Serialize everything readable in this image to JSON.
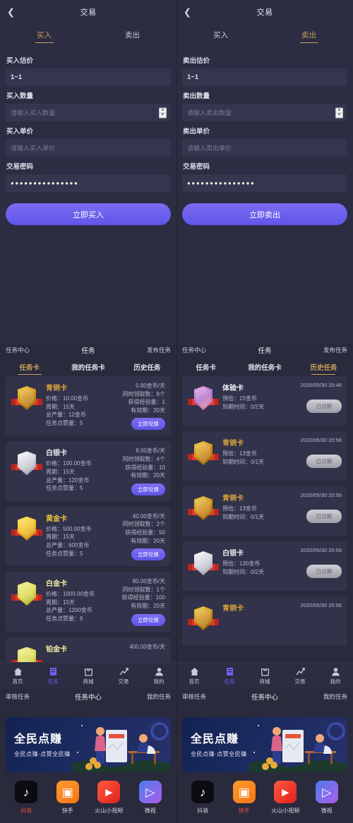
{
  "colors": {
    "background": "#2a2a3d",
    "panel": "#2c2c42",
    "card": "#32324a",
    "accent_gold": "#c9a25a",
    "accent_purple": "#6f62ee",
    "active_red": "#e8503a"
  },
  "trade": {
    "back_icon": "chevron-left-icon",
    "title": "交易",
    "tabs": [
      {
        "label": "买入"
      },
      {
        "label": "卖出"
      }
    ],
    "buy": {
      "active_tab": 0,
      "fields": [
        {
          "label": "买入估价",
          "value": "1~1",
          "placeholder": "",
          "type": "value"
        },
        {
          "label": "买入数量",
          "value": "",
          "placeholder": "请输入买入数量",
          "type": "spinner"
        },
        {
          "label": "买入单价",
          "value": "",
          "placeholder": "请输入买入单价",
          "type": "text"
        },
        {
          "label": "交易密码",
          "value": "●●●●●●●●●●●●●●●",
          "placeholder": "",
          "type": "password"
        }
      ],
      "submit_label": "立即买入"
    },
    "sell": {
      "active_tab": 1,
      "fields": [
        {
          "label": "卖出估价",
          "value": "1~1",
          "placeholder": "",
          "type": "value"
        },
        {
          "label": "卖出数量",
          "value": "",
          "placeholder": "请输入卖出数量",
          "type": "spinner"
        },
        {
          "label": "卖出单价",
          "value": "",
          "placeholder": "请输入卖出单价",
          "type": "text"
        },
        {
          "label": "交易密码",
          "value": "●●●●●●●●●●●●●●●",
          "placeholder": "",
          "type": "password"
        }
      ],
      "submit_label": "立即卖出"
    }
  },
  "task_header": {
    "left": "任务中心",
    "center": "任务",
    "right": "发布任务"
  },
  "task_tabs": [
    {
      "label": "任务卡"
    },
    {
      "label": "我的任务卡"
    },
    {
      "label": "历史任务"
    }
  ],
  "task_cards": {
    "active_tab": 0,
    "items": [
      {
        "name": "青铜卡",
        "tier": "bronze",
        "price": "价格：10.00金币",
        "cycle": "周期：15天",
        "total": "总产量：12金币",
        "points": "任务点赞量：5",
        "rate": "0.80金币/天",
        "concurrent": "同时领取数：8个",
        "exp": "获得经验量：1",
        "valid": "有效期：20天",
        "button": "立即兑换"
      },
      {
        "name": "白银卡",
        "tier": "silver",
        "price": "价格：100.00金币",
        "cycle": "周期：15天",
        "total": "总产量：120金币",
        "points": "任务点赞量：5",
        "rate": "8.00金币/天",
        "concurrent": "同时领取数：4个",
        "exp": "获得经验量：10",
        "valid": "有效期：20天",
        "button": "立即兑换"
      },
      {
        "name": "黄金卡",
        "tier": "gold",
        "price": "价格：500.00金币",
        "cycle": "周期：15天",
        "total": "总产量：600金币",
        "points": "任务点赞量：5",
        "rate": "40.00金币/天",
        "concurrent": "同时领取数：2个",
        "exp": "获得经验量：50",
        "valid": "有效期：20天",
        "button": "立即兑换"
      },
      {
        "name": "白金卡",
        "tier": "plat",
        "price": "价格：1000.00金币",
        "cycle": "周期：15天",
        "total": "总产量：1200金币",
        "points": "任务点赞量：6",
        "rate": "80.00金币/天",
        "concurrent": "同时领取数：1个",
        "exp": "获得经验量：100",
        "valid": "有效期：20天",
        "button": "立即兑换"
      },
      {
        "name": "铂金卡",
        "tier": "plat",
        "price": "",
        "cycle": "",
        "total": "",
        "points": "",
        "rate": "400.00金币/天",
        "concurrent": "",
        "exp": "",
        "valid": "",
        "button": ""
      }
    ]
  },
  "history_tasks": {
    "active_tab": 2,
    "items": [
      {
        "name": "体验卡",
        "tier": "exp",
        "estimate": "预估：15金币",
        "expiry": "到期时间：0/2天",
        "date": "2020/05/30 20:46",
        "status": "已过期"
      },
      {
        "name": "青铜卡",
        "tier": "bronze",
        "estimate": "预估：13金币",
        "expiry": "到期时间：0/1天",
        "date": "2020/05/30 20:56",
        "status": "已过期"
      },
      {
        "name": "青铜卡",
        "tier": "bronze",
        "estimate": "预估：13金币",
        "expiry": "到期时间：0/1天",
        "date": "2020/05/30 20:56",
        "status": "已过期"
      },
      {
        "name": "白银卡",
        "tier": "silver",
        "estimate": "预估：130金币",
        "expiry": "到期时间：0/2天",
        "date": "2020/05/30 20:56",
        "status": "已过期"
      },
      {
        "name": "青铜卡",
        "tier": "bronze",
        "estimate": "",
        "expiry": "",
        "date": "2020/05/30 20:56",
        "status": ""
      }
    ]
  },
  "bottom_nav": {
    "active_index": 1,
    "items": [
      {
        "label": "首页",
        "icon": "home-icon"
      },
      {
        "label": "任务",
        "icon": "task-icon"
      },
      {
        "label": "商城",
        "icon": "shop-bag-icon"
      },
      {
        "label": "交易",
        "icon": "chart-trend-icon"
      },
      {
        "label": "我的",
        "icon": "person-icon"
      }
    ]
  },
  "sub_nav": {
    "left": "审核任务",
    "center": "任务中心",
    "right": "我的任务"
  },
  "promo": {
    "banner_title": "全民点赚",
    "banner_subtitle": "全民点赚·点赞全民赚"
  },
  "apps": {
    "left_active_index": 0,
    "right_active_index": 1,
    "items": [
      {
        "label": "抖音",
        "icon": "douyin-icon"
      },
      {
        "label": "快手",
        "icon": "kuaishou-icon"
      },
      {
        "label": "火山小视频",
        "icon": "huoshan-icon"
      },
      {
        "label": "微视",
        "icon": "weishi-icon"
      }
    ]
  }
}
